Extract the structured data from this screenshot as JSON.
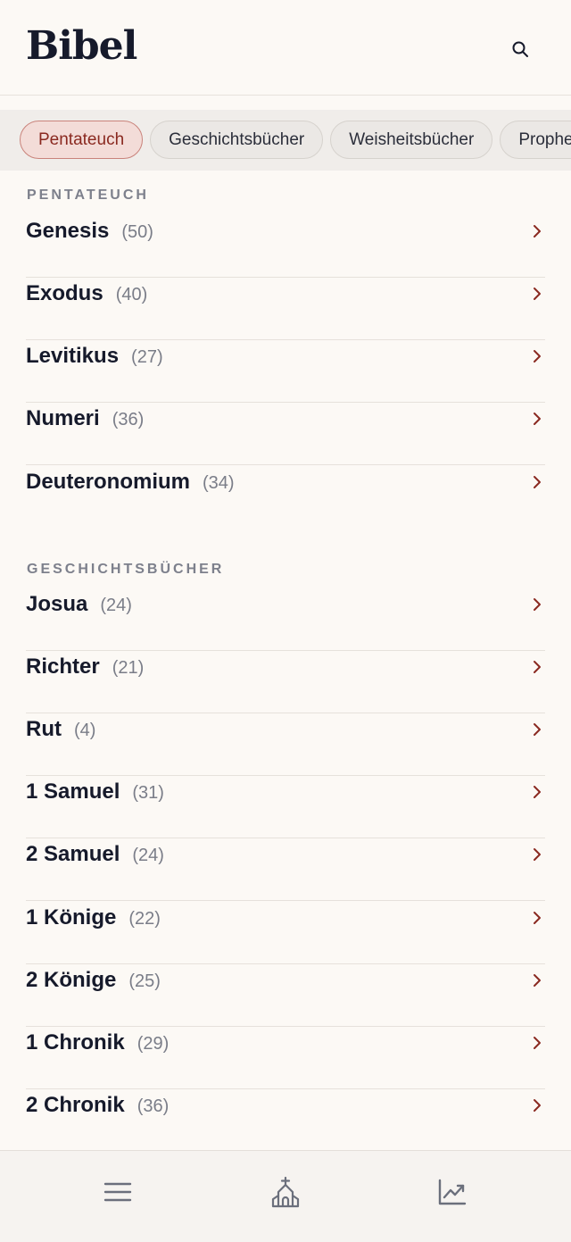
{
  "header": {
    "title": "Bibel",
    "search_icon": "search-icon"
  },
  "chips": [
    {
      "label": "Pentateuch",
      "active": true
    },
    {
      "label": "Geschichtsbücher",
      "active": false
    },
    {
      "label": "Weisheitsbücher",
      "active": false
    },
    {
      "label": "Propheten",
      "active": false
    }
  ],
  "sections": [
    {
      "label": "PENTATEUCH",
      "books": [
        {
          "name": "Genesis",
          "count": "(50)"
        },
        {
          "name": "Exodus",
          "count": "(40)"
        },
        {
          "name": "Levitikus",
          "count": "(27)"
        },
        {
          "name": "Numeri",
          "count": "(36)"
        },
        {
          "name": "Deuteronomium",
          "count": "(34)"
        }
      ]
    },
    {
      "label": "GESCHICHTSBÜCHER",
      "books": [
        {
          "name": "Josua",
          "count": "(24)"
        },
        {
          "name": "Richter",
          "count": "(21)"
        },
        {
          "name": "Rut",
          "count": "(4)"
        },
        {
          "name": "1 Samuel",
          "count": "(31)"
        },
        {
          "name": "2 Samuel",
          "count": "(24)"
        },
        {
          "name": "1 Könige",
          "count": "(22)"
        },
        {
          "name": "2 Könige",
          "count": "(25)"
        },
        {
          "name": "1 Chronik",
          "count": "(29)"
        },
        {
          "name": "2 Chronik",
          "count": "(36)"
        }
      ]
    }
  ],
  "bottom_nav": [
    {
      "icon": "menu-icon"
    },
    {
      "icon": "church-icon"
    },
    {
      "icon": "chart-icon"
    }
  ],
  "colors": {
    "background": "#fcf9f5",
    "accent": "#8a2920",
    "chip_active_bg": "#f3dcd8",
    "text": "#161a2b",
    "muted": "#7a7d88"
  }
}
